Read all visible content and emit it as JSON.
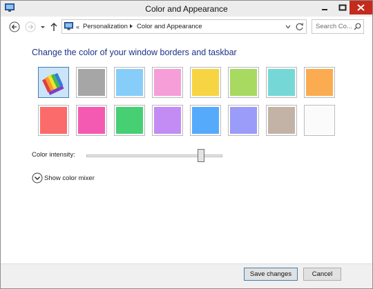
{
  "window": {
    "title": "Color and Appearance",
    "controls": [
      "minimize-icon",
      "maximize-icon",
      "close-icon"
    ]
  },
  "address": {
    "overflow": "«",
    "crumbs": [
      "Personalization",
      "Color and Appearance"
    ],
    "search_placeholder": "Search Co..."
  },
  "main": {
    "heading": "Change the color of your window borders and taskbar",
    "swatches": [
      {
        "name": "automatic",
        "color": "#cce4f7",
        "selected": true
      },
      {
        "name": "gray",
        "color": "#a6a6a6"
      },
      {
        "name": "sky-blue",
        "color": "#87cdf9"
      },
      {
        "name": "pink",
        "color": "#f59ed8"
      },
      {
        "name": "yellow",
        "color": "#f7d442"
      },
      {
        "name": "lime",
        "color": "#a8d961"
      },
      {
        "name": "turquoise",
        "color": "#76d8d6"
      },
      {
        "name": "orange",
        "color": "#fbab50"
      },
      {
        "name": "red",
        "color": "#fb6b6b"
      },
      {
        "name": "magenta",
        "color": "#f45ab1"
      },
      {
        "name": "green",
        "color": "#47cf74"
      },
      {
        "name": "purple",
        "color": "#c38cf5"
      },
      {
        "name": "blue",
        "color": "#55aafb"
      },
      {
        "name": "periwinkle",
        "color": "#9b9bf9"
      },
      {
        "name": "taupe",
        "color": "#c2b3a6"
      },
      {
        "name": "white",
        "color": "#fbfbfb"
      }
    ],
    "intensity_label": "Color intensity:",
    "intensity_value": 0.86,
    "mixer_label": "Show color mixer"
  },
  "footer": {
    "save_label": "Save changes",
    "cancel_label": "Cancel"
  },
  "colors": {
    "heading": "#1e3287",
    "close": "#c42b1c",
    "accent": "#3c7fb1"
  }
}
